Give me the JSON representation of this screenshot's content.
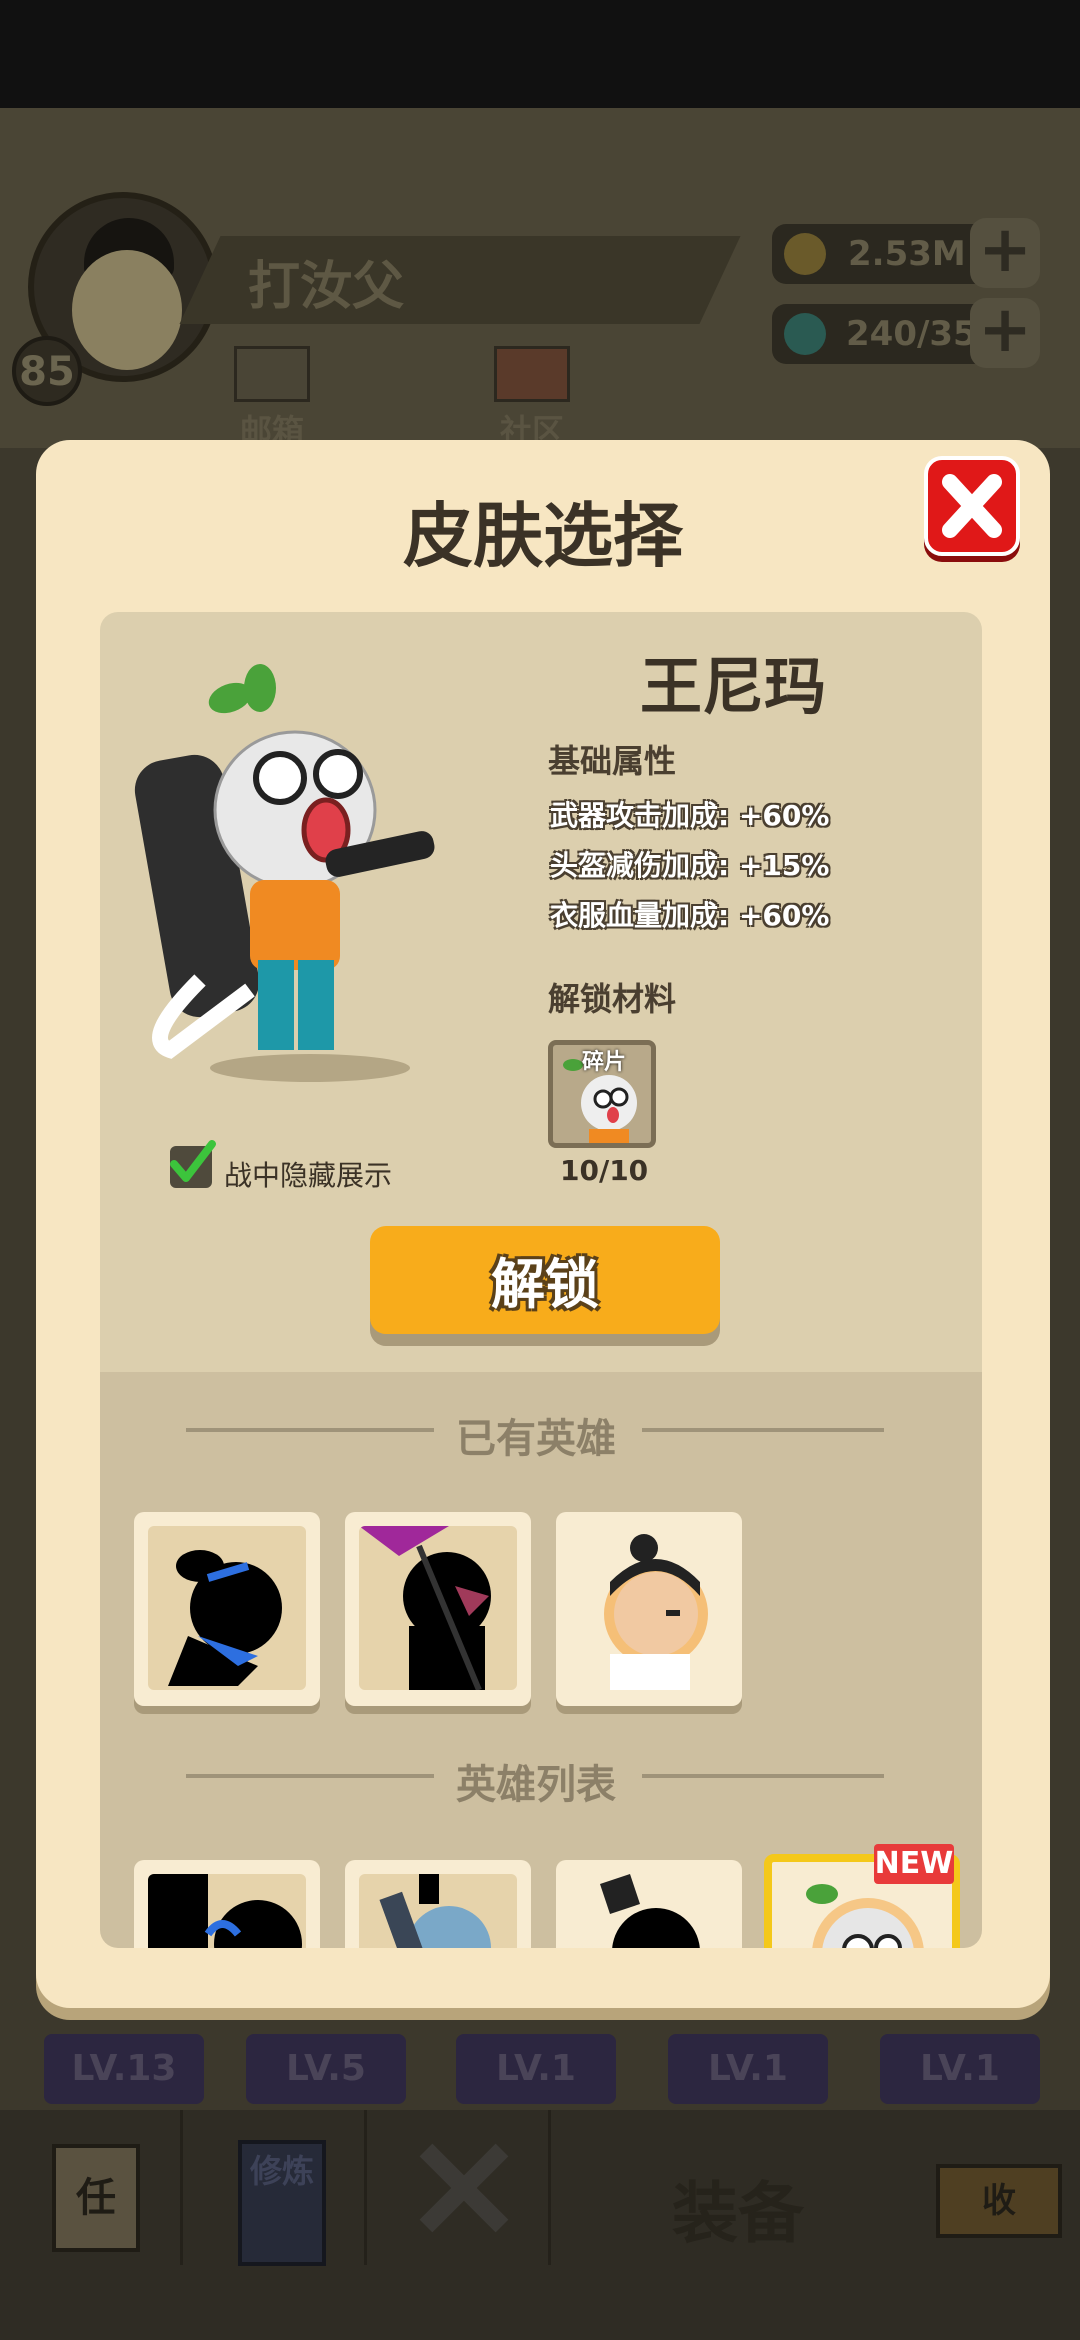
{
  "player": {
    "name": "打汝父",
    "level": "85"
  },
  "currency": {
    "gold": "2.53M",
    "gems": "240/35"
  },
  "top_buttons": {
    "mail": "邮箱",
    "community": "社区"
  },
  "modal": {
    "title": "皮肤选择",
    "hero_name": "王尼玛",
    "attributes_title": "基础属性",
    "attributes": [
      "武器攻击加成: +60%",
      "头盔减伤加成: +15%",
      "衣服血量加成: +60%"
    ],
    "unlock_material_title": "解锁材料",
    "fragment_label": "碎片",
    "fragment_count": "10/10",
    "hide_in_battle_label": "战中隐藏展示",
    "hide_in_battle_checked": true,
    "unlock_button": "解锁",
    "owned_heroes_title": "已有英雄",
    "hero_list_title": "英雄列表",
    "new_badge": "NEW"
  },
  "bottom_levels": [
    "LV.13",
    "LV.5",
    "LV.1",
    "LV.1",
    "LV.1"
  ],
  "bottom_nav": {
    "task_icon_text": "任",
    "practice_icon_text": "修炼",
    "equip_label": "装备",
    "collect_icon_text": "收"
  },
  "colors": {
    "accent_orange": "#f8ac1b",
    "close_red": "#e01818",
    "modal_bg": "#f7e6c2",
    "panel_bg": "#dccfae"
  }
}
